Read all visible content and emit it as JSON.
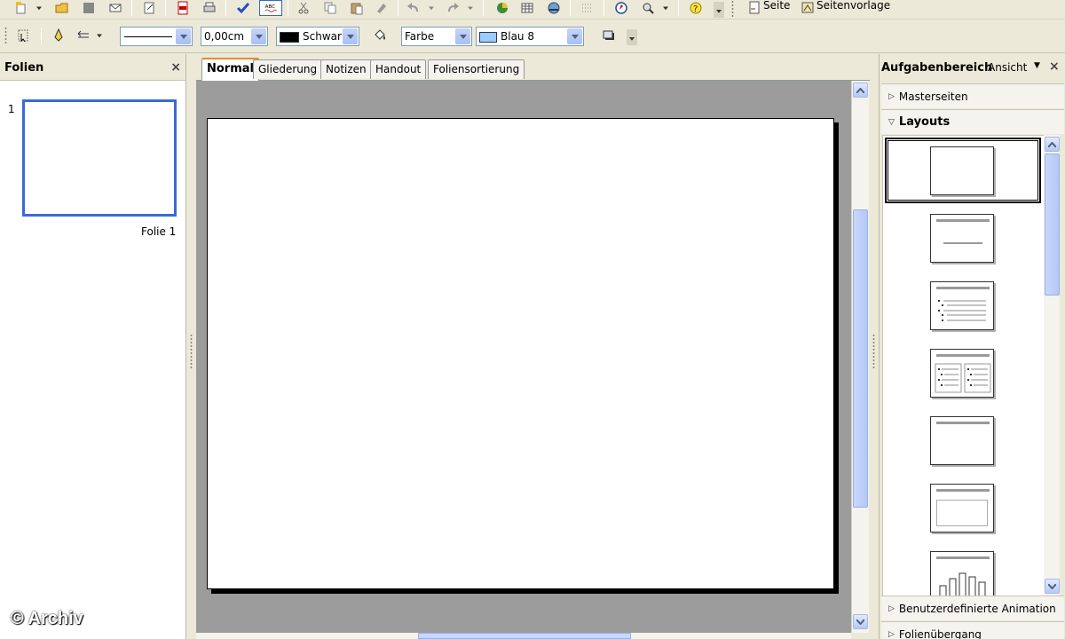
{
  "toolbar_top": {
    "page_label": "Seite",
    "master_label": "Seitenvorlage"
  },
  "toolbar_line": {
    "line_width": "0,00cm",
    "line_color": "Schwar",
    "area_style": "Farbe",
    "area_color": "Blau 8",
    "colors": {
      "line_color": "#000000",
      "area_color": "#99ccff"
    }
  },
  "slides_pane": {
    "title": "Folien",
    "close": "×",
    "slides": [
      {
        "number": "1",
        "label": "Folie 1"
      }
    ]
  },
  "view_tabs": [
    "Normal",
    "Gliederung",
    "Notizen",
    "Handout",
    "Foliensortierung"
  ],
  "task_pane": {
    "title": "Aufgabenbereich",
    "view_menu": "Ansicht",
    "close": "×",
    "sections": {
      "master_pages": "Masterseiten",
      "layouts": "Layouts",
      "custom_animation": "Benutzerdefinierte Animation",
      "slide_transition": "Folienübergang"
    }
  },
  "watermark": "© Archiv",
  "accent_colors": {
    "active_tab_top": "#e68b2c",
    "selected_thumb": "#3a6ad6"
  }
}
